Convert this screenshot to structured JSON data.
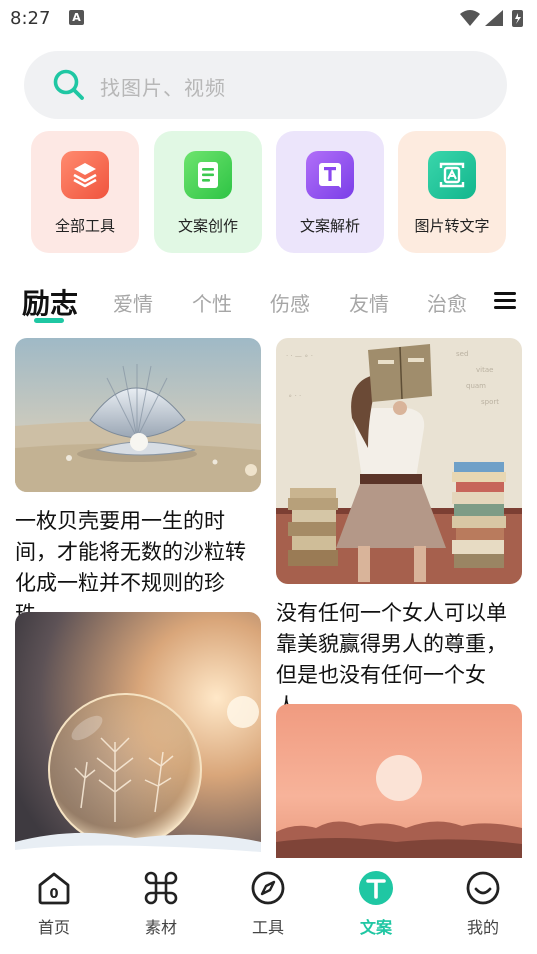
{
  "status_bar": {
    "time": "8:27",
    "notification_letter": "A"
  },
  "search": {
    "placeholder": "找图片、视频"
  },
  "tools": [
    {
      "label": "全部工具",
      "icon": "layers-icon",
      "bg": "#fde8e4",
      "icon_color": "#f2644c"
    },
    {
      "label": "文案创作",
      "icon": "document-icon",
      "bg": "#e1f8e4",
      "icon_color": "#3ecf52"
    },
    {
      "label": "文案解析",
      "icon": "text-parse-icon",
      "bg": "#ece5fb",
      "icon_color": "#8e4df0"
    },
    {
      "label": "图片转文字",
      "icon": "image-to-text-icon",
      "bg": "#fdebdf",
      "icon_color": "#1fc39a"
    }
  ],
  "tabs": [
    "励志",
    "爱情",
    "个性",
    "伤感",
    "友情",
    "治愈"
  ],
  "active_tab": "励志",
  "accent_color": "#1fc7a3",
  "cards": [
    {
      "text": "一枚贝壳要用一生的时间，才能将无数的沙粒转化成一粒并不规则的珍珠…",
      "image": "seashell-on-beach"
    },
    {
      "text": "没有任何一个女人可以单靠美貌赢得男人的尊重，但是也没有任何一个女人…",
      "image": "woman-reading-book"
    },
    {
      "text": "",
      "image": "frozen-bubble"
    },
    {
      "text": "",
      "image": "sunset-over-mountains"
    }
  ],
  "bottom_nav": [
    {
      "label": "首页",
      "icon": "home-icon"
    },
    {
      "label": "素材",
      "icon": "command-icon"
    },
    {
      "label": "工具",
      "icon": "compass-icon"
    },
    {
      "label": "文案",
      "icon": "text-t-icon"
    },
    {
      "label": "我的",
      "icon": "smile-icon"
    }
  ],
  "active_nav": "文案"
}
